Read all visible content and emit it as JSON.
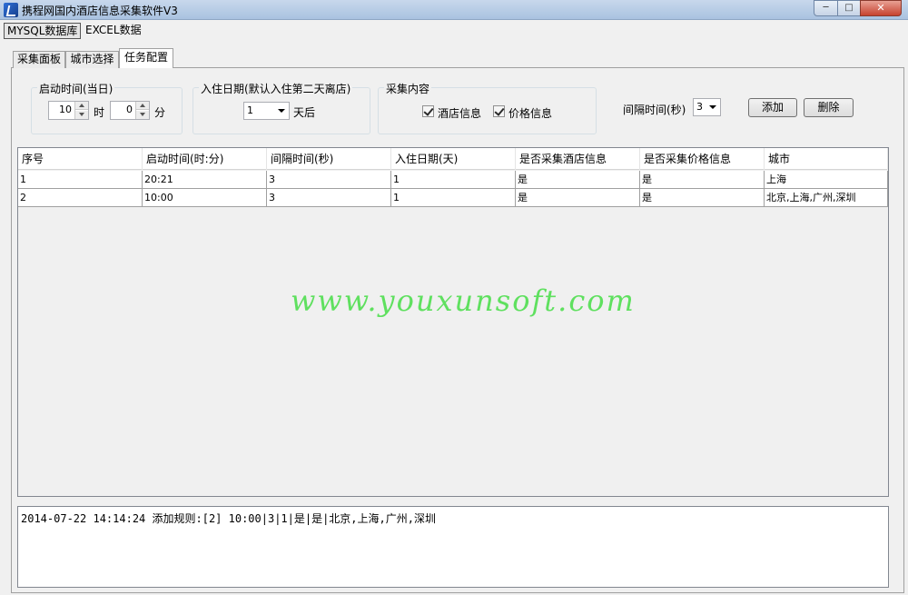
{
  "window": {
    "title": "携程网国内酒店信息采集软件V3",
    "min": "─",
    "max": "□",
    "close": "✕"
  },
  "menu": {
    "mysql": "MYSQL数据库",
    "excel": "EXCEL数据"
  },
  "tabs": {
    "collect": "采集面板",
    "city": "城市选择",
    "task": "任务配置"
  },
  "config": {
    "start_group": "启动时间(当日)",
    "hour_value": "10",
    "hour_unit": "时",
    "minute_value": "0",
    "minute_unit": "分",
    "checkin_group": "入住日期(默认入住第二天离店)",
    "checkin_value": "1",
    "checkin_suffix": "天后",
    "content_group": "采集内容",
    "hotel_info": "酒店信息",
    "price_info": "价格信息",
    "interval_label": "间隔时间(秒)",
    "interval_value": "3",
    "add_btn": "添加",
    "delete_btn": "删除"
  },
  "table": {
    "headers": [
      "序号",
      "启动时间(时:分)",
      "间隔时间(秒)",
      "入住日期(天)",
      "是否采集酒店信息",
      "是否采集价格信息",
      "城市"
    ],
    "rows": [
      [
        "1",
        "20:21",
        "3",
        "1",
        "是",
        "是",
        "上海"
      ],
      [
        "2",
        "10:00",
        "3",
        "1",
        "是",
        "是",
        "北京,上海,广州,深圳"
      ]
    ]
  },
  "watermark": "www.youxunsoft.com",
  "log": "2014-07-22 14:14:24  添加规则:[2] 10:00|3|1|是|是|北京,上海,广州,深圳"
}
